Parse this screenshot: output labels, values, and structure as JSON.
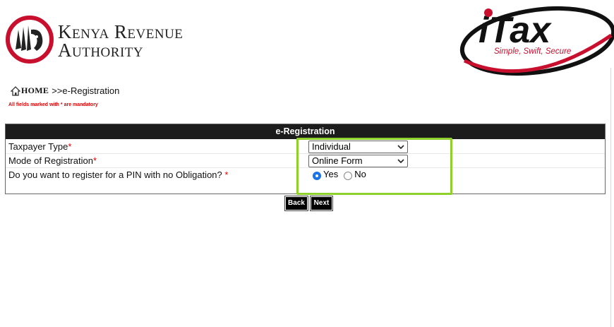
{
  "header": {
    "kra_line1": "Kenya Revenue",
    "kra_line2": "Authority",
    "itax_text": "iTax",
    "itax_tagline": "Simple, Swift, Secure"
  },
  "breadcrumb": {
    "home_label": "HOME",
    "current": ">>e-Registration"
  },
  "mandatory_note": "All fields marked with * are mandatory",
  "form": {
    "title": "e-Registration",
    "taxpayer_type_label": "Taxpayer Type",
    "taxpayer_type_value": "Individual",
    "mode_label": "Mode of Registration",
    "mode_value": "Online Form",
    "no_obligation_label": "Do you want to register for a PIN with no Obligation?",
    "required_mark": "*",
    "radio_yes": "Yes",
    "radio_no": "No",
    "radio_selected": "Yes"
  },
  "buttons": {
    "back": "Back",
    "next": "Next"
  },
  "colors": {
    "kra_red": "#c8102e",
    "header_bar": "#1c1c1c",
    "highlight": "#8fd02c",
    "radio_selected": "#1a73e8"
  }
}
